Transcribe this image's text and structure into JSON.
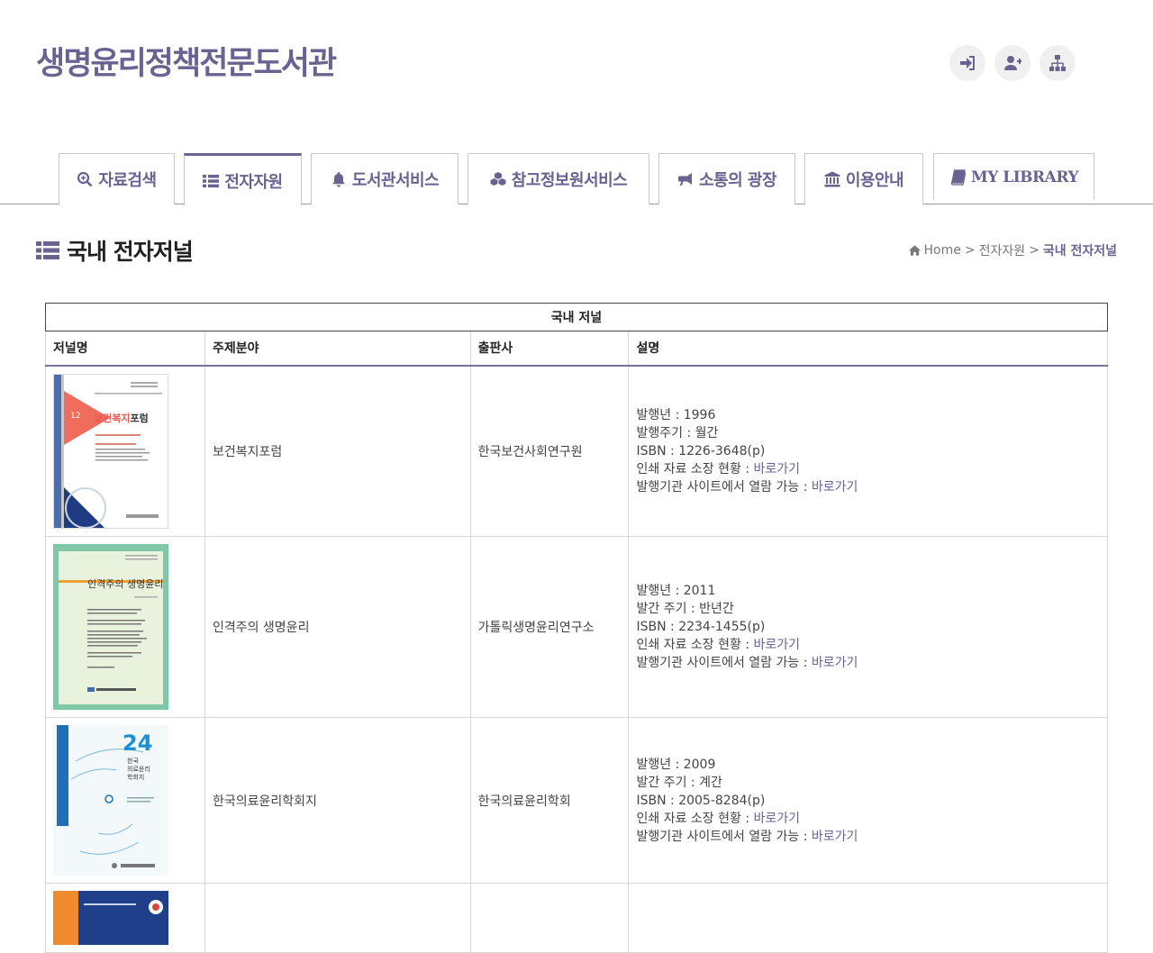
{
  "site": {
    "title": "생명윤리정책전문도서관"
  },
  "header_icons": [
    "sign-in-icon",
    "user-plus-icon",
    "sitemap-icon"
  ],
  "nav": {
    "tabs": [
      {
        "label": "자료검색",
        "icon": "search-icon"
      },
      {
        "label": "전자자원",
        "icon": "list-icon",
        "active": true
      },
      {
        "label": "도서관서비스",
        "icon": "bell-icon"
      },
      {
        "label": "참고정보원서비스",
        "icon": "cubes-icon"
      },
      {
        "label": "소통의 광장",
        "icon": "bullhorn-icon"
      },
      {
        "label": "이용안내",
        "icon": "institution-icon"
      },
      {
        "label": "MY LIBRARY",
        "icon": "book-icon"
      }
    ]
  },
  "page": {
    "title": "국내 전자저널",
    "breadcrumb": {
      "home": "Home",
      "sep": ">",
      "parent": "전자자원",
      "current": "국내 전자저널"
    }
  },
  "table": {
    "caption": "국내 저널",
    "headers": [
      "저널명",
      "주제분야",
      "출판사",
      "설명"
    ],
    "rows": [
      {
        "subject": "보건복지포럼",
        "publisher": "한국보건사회연구원",
        "cover": {
          "number": "12",
          "title_red": "보건복지",
          "title_dark": "포럼"
        },
        "desc": {
          "line1": "발행년 : 1996",
          "line2": "발행주기 : 월간",
          "line3": "ISBN : 1226-3648(p)",
          "print_label": "인쇄 자료 소장 현황 : ",
          "print_link": "바로가기",
          "site_label": "발행기관 사이트에서 열람 가능 : ",
          "site_link": "바로가기"
        }
      },
      {
        "subject": "인격주의 생명윤리",
        "publisher": "가톨릭생명윤리연구소",
        "cover": {
          "title": "인격주의 생명윤리"
        },
        "desc": {
          "line1": "발행년 : 2011",
          "line2": "발간 주기 : 반년간",
          "line3": "ISBN : 2234-1455(p)",
          "print_label": "인쇄 자료 소장 현황 : ",
          "print_link": "바로가기",
          "site_label": "발행기관 사이트에서 열람 가능 : ",
          "site_link": "바로가기"
        }
      },
      {
        "subject": "한국의료윤리학회지",
        "publisher": "한국의료윤리학회",
        "cover": {
          "number": "24",
          "title_l1": "한국",
          "title_l2": "의료윤리",
          "title_l3": "학회지"
        },
        "desc": {
          "line1": "발행년 : 2009",
          "line2": "발간 주기 : 계간",
          "line3": "ISBN : 2005-8284(p)",
          "print_label": "인쇄 자료 소장 현황 : ",
          "print_link": "바로가기",
          "site_label": "발행기관 사이트에서 열람 가능 : ",
          "site_link": "바로가기"
        }
      }
    ]
  },
  "colors": {
    "brand": "#6a6291",
    "tab_border": "#c8c8c8"
  }
}
